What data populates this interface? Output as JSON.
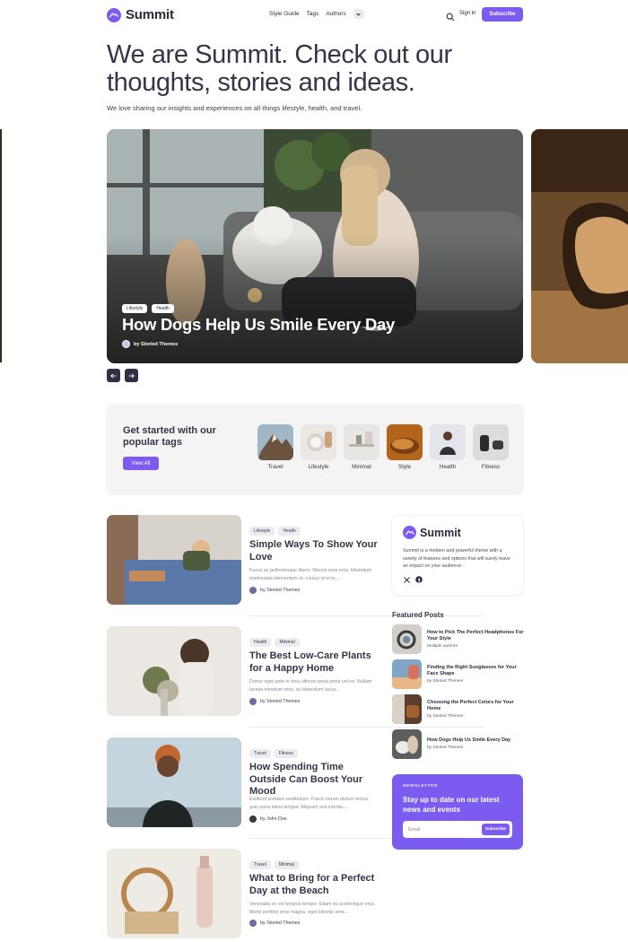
{
  "header": {
    "logo_text": "Summit",
    "nav": [
      "Style Guide",
      "Tags",
      "Authors"
    ],
    "signin_label": "Sign in",
    "subscribe_label": "Subscribe"
  },
  "hero": {
    "title": "We are Summit. Check out our thoughts, stories and ideas.",
    "subtitle": "We love sharing our insights and experiences on all things lifestyle, health, and travel."
  },
  "slider": {
    "tags": [
      "Lifestyle",
      "Health"
    ],
    "title": "How Dogs Help Us Smile Every Day",
    "author": "by Storied Themes"
  },
  "tags_panel": {
    "heading": "Get started with our popular tags",
    "view_all_label": "View All",
    "tags": [
      {
        "label": "Travel"
      },
      {
        "label": "Lifestyle"
      },
      {
        "label": "Minimal"
      },
      {
        "label": "Style"
      },
      {
        "label": "Health"
      },
      {
        "label": "Fitness"
      }
    ]
  },
  "posts": [
    {
      "tags": [
        "Lifestyle",
        "Health"
      ],
      "title": "Simple Ways To Show Your Love",
      "excerpt": "Fusce ac pellentesque libero. Mauris urna eros, bibendum malesuada elementum ut, cursus ut eros,...",
      "author": "by Storied Themes"
    },
    {
      "tags": [
        "Health",
        "Minimal"
      ],
      "title": "The Best Low-Care Plants for a Happy Home",
      "excerpt": "Donec eget ante in eros ultrices porta porta vel ex. Nullam lacinia interdum eros, eu bibendum lacus...",
      "author": "by Storied Themes"
    },
    {
      "tags": [
        "Travel",
        "Fitness"
      ],
      "title": "How Spending Time Outside Can Boost Your Mood",
      "excerpt": "Eleifend sodales vestibulum. Fusce rutrum dictum lectus, quis porta tellus tempor. Aliquam sed interdu...",
      "author": "by John Doe"
    },
    {
      "tags": [
        "Travel",
        "Minimal"
      ],
      "title": "What to Bring for a Perfect Day at the Beach",
      "excerpt": "Venenatis ex vel tempus tempor. Etiam eu scelerisque eros. Morbi porttitor eros magna, eget lobortis ante...",
      "author": "by Storied Themes"
    }
  ],
  "about": {
    "logo_text": "Summit",
    "text": "Summit is a modern and powerful theme with a variety of features and options that will surely leave an impact on your audience.",
    "social": [
      "x-icon",
      "facebook-icon"
    ]
  },
  "featured": {
    "heading": "Featured Posts",
    "items": [
      {
        "title": "How to Pick The Perfect Headphones For Your Style",
        "author": "Multiple authors"
      },
      {
        "title": "Finding the Right Sunglasses for Your Face Shape",
        "author": "by Storied Themes"
      },
      {
        "title": "Choosing the Perfect Colors for Your Home",
        "author": "by Storied Themes"
      },
      {
        "title": "How Dogs Help Us Smile Every Day",
        "author": "by Storied Themes"
      }
    ]
  },
  "newsletter": {
    "label": "NEWSLETTER",
    "heading": "Stay up to date on our latest news and events",
    "email_placeholder": "Email",
    "submit_label": "Subscribe"
  },
  "colors": {
    "accent": "#7c5cf0",
    "text": "#34354a",
    "panel": "#f4f4f5"
  }
}
